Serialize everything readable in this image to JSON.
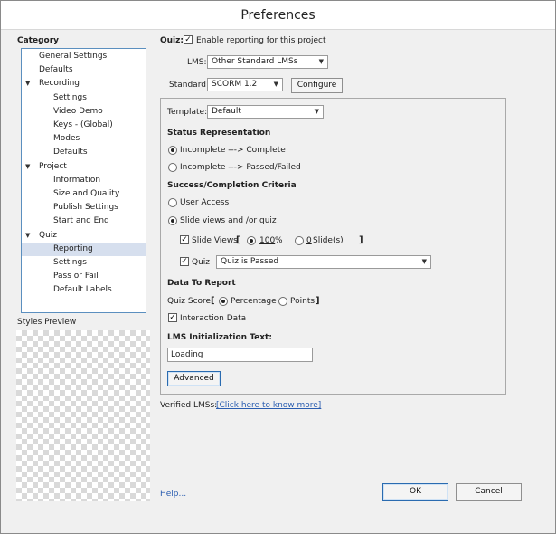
{
  "window": {
    "title": "Preferences"
  },
  "category": {
    "label": "Category",
    "items": [
      {
        "label": "General Settings",
        "level": 0
      },
      {
        "label": "Defaults",
        "level": 0
      },
      {
        "label": "Recording",
        "level": 0,
        "expanded": true
      },
      {
        "label": "Settings",
        "level": 1
      },
      {
        "label": "Video Demo",
        "level": 1
      },
      {
        "label": "Keys - (Global)",
        "level": 1
      },
      {
        "label": "Modes",
        "level": 1
      },
      {
        "label": "Defaults",
        "level": 1
      },
      {
        "label": "Project",
        "level": 0,
        "expanded": true
      },
      {
        "label": "Information",
        "level": 1
      },
      {
        "label": "Size and Quality",
        "level": 1
      },
      {
        "label": "Publish Settings",
        "level": 1
      },
      {
        "label": "Start and End",
        "level": 1
      },
      {
        "label": "Quiz",
        "level": 0,
        "expanded": true
      },
      {
        "label": "Reporting",
        "level": 1,
        "selected": true
      },
      {
        "label": "Settings",
        "level": 1
      },
      {
        "label": "Pass or Fail",
        "level": 1
      },
      {
        "label": "Default Labels",
        "level": 1
      }
    ]
  },
  "styles_preview": {
    "label": "Styles Preview"
  },
  "quiz": {
    "label": "Quiz:",
    "enable_reporting": {
      "label": "Enable reporting for this project",
      "checked": true
    }
  },
  "lms": {
    "label": "LMS:",
    "value": "Other Standard LMSs"
  },
  "standard": {
    "label": "Standard:",
    "value": "SCORM 1.2",
    "configure_label": "Configure"
  },
  "template": {
    "label": "Template:",
    "value": "Default"
  },
  "status_representation": {
    "heading": "Status Representation",
    "options": [
      {
        "label": "Incomplete ---> Complete",
        "selected": true
      },
      {
        "label": "Incomplete ---> Passed/Failed",
        "selected": false
      }
    ]
  },
  "success_criteria": {
    "heading": "Success/Completion Criteria",
    "user_access": {
      "label": "User Access",
      "selected": false
    },
    "slide_views_quiz": {
      "label": "Slide views and /or quiz",
      "selected": true
    },
    "slide_views": {
      "label": "Slide Views",
      "checked": true,
      "bracket_open": "[",
      "bracket_close": "]",
      "percent_value": "100",
      "percent_unit": "%",
      "percent_selected": true,
      "slides_value": "0",
      "slides_unit": "Slide(s)",
      "slides_selected": false
    },
    "quiz": {
      "label": "Quiz",
      "checked": true,
      "value": "Quiz is Passed"
    }
  },
  "data_to_report": {
    "heading": "Data To Report",
    "quiz_score_label": "Quiz Score",
    "bracket_open": "[",
    "bracket_close": "]",
    "percentage": {
      "label": "Percentage",
      "selected": true
    },
    "points": {
      "label": "Points",
      "selected": false
    },
    "interaction_data": {
      "label": "Interaction Data",
      "checked": true
    }
  },
  "lms_init": {
    "heading": "LMS Initialization Text:",
    "value": "Loading"
  },
  "advanced_label": "Advanced",
  "verified": {
    "label": "Verified LMSs:",
    "link": "[Click here to know more]"
  },
  "footer": {
    "help": "Help...",
    "ok": "OK",
    "cancel": "Cancel"
  }
}
